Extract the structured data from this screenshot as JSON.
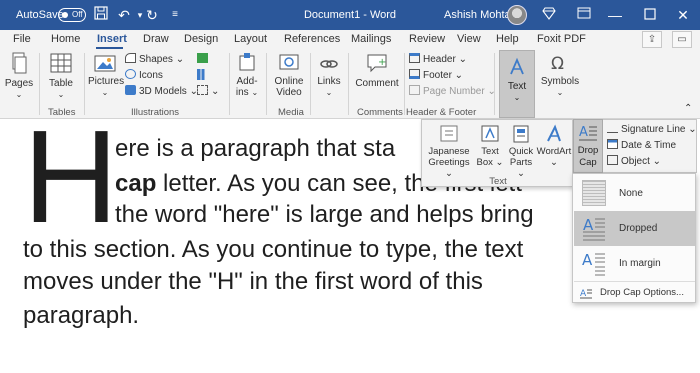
{
  "titlebar": {
    "autosave_label": "AutoSave",
    "autosave_state": "Off",
    "document_title": "Document1  -  Word",
    "user_name": "Ashish Mohta"
  },
  "tabs": [
    "File",
    "Home",
    "Insert",
    "Draw",
    "Design",
    "Layout",
    "References",
    "Mailings",
    "Review",
    "View",
    "Help",
    "Foxit PDF"
  ],
  "active_tab": "Insert",
  "ribbon": {
    "pages": "Pages",
    "table": "Table",
    "tables_group": "Tables",
    "pictures": "Pictures",
    "shapes": "Shapes",
    "icons": "Icons",
    "models_3d": "3D Models",
    "illustrations_group": "Illustrations",
    "addins_line1": "Add-",
    "addins_line2": "ins",
    "online_video_line1": "Online",
    "online_video_line2": "Video",
    "media_group": "Media",
    "links": "Links",
    "comment": "Comment",
    "comments_group": "Comments",
    "header": "Header",
    "footer": "Footer",
    "page_number": "Page Number",
    "header_footer_group": "Header & Footer",
    "text": "Text",
    "symbols": "Symbols"
  },
  "text_flyout": {
    "japanese_line1": "Japanese",
    "japanese_line2": "Greetings",
    "textbox_line1": "Text",
    "textbox_line2": "Box",
    "quickparts_line1": "Quick",
    "quickparts_line2": "Parts",
    "wordart": "WordArt",
    "group_label": "Text",
    "dropcap_line1": "Drop",
    "dropcap_line2": "Cap",
    "signature_line": "Signature Line",
    "date_time": "Date & Time",
    "object": "Object"
  },
  "dropcap_menu": {
    "items": [
      "None",
      "Dropped",
      "In margin"
    ],
    "selected": "Dropped",
    "options": "Drop Cap Options..."
  },
  "document": {
    "dropcap_letter": "H",
    "line1": "ere is a paragraph that sta",
    "line2_bold": "cap",
    "line2_rest": " letter. As you can see, the first lett",
    "line3": "the word \"here\" is large and helps bring",
    "line4": "to this section. As you continue to type, the text",
    "line5": "moves under the \"H\" in the first word of this",
    "line6": "paragraph."
  },
  "colors": {
    "title_bar": "#2b579a",
    "ribbon_bg": "#f3f3f3",
    "selected_bg": "#c8c8c8",
    "accent": "#2b579a"
  }
}
